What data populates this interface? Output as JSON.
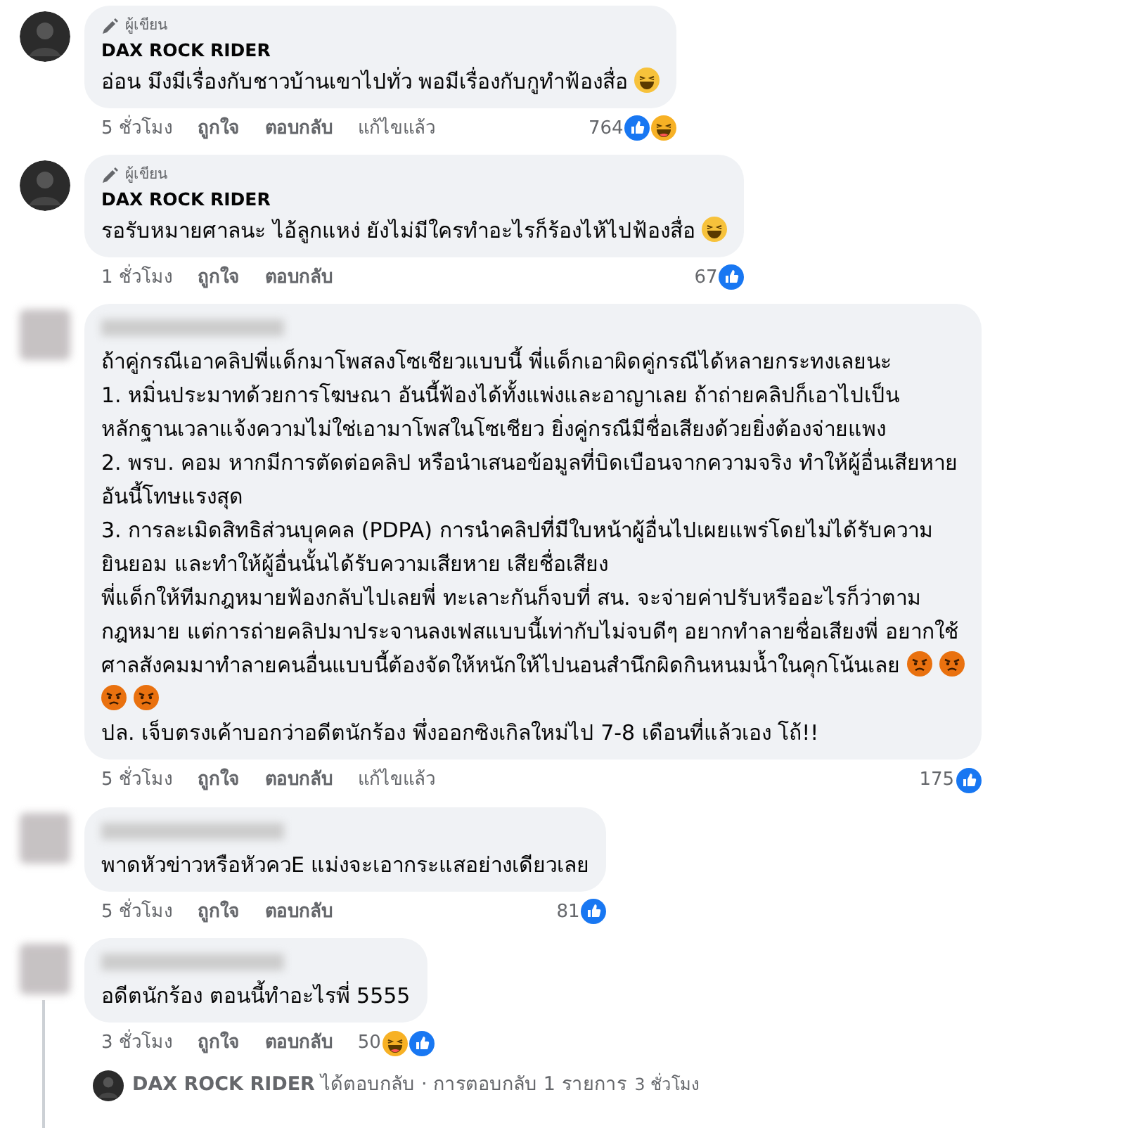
{
  "comments": [
    {
      "avatar": {
        "kind": "photo"
      },
      "author_badge": "ผู้เขียน",
      "name": "DAX ROCK RIDER",
      "paragraphs": [
        [
          {
            "text": "อ่อน มึงมีเรื่องกับชาวบ้านเขาไปทั่ว พอมีเรื่องกับกูทำฟ้องสื่อ",
            "emojis": [
              {
                "kind": "laugh"
              }
            ]
          }
        ]
      ],
      "time": "5 ชั่วโมง",
      "actions": [
        "ถูกใจ",
        "ตอบกลับ"
      ],
      "edited": "แก้ไขแล้ว",
      "count": "764",
      "reactions": [
        {
          "kind": "like"
        },
        {
          "kind": "haha"
        }
      ]
    },
    {
      "avatar": {
        "kind": "photo"
      },
      "author_badge": "ผู้เขียน",
      "name": "DAX ROCK RIDER",
      "paragraphs": [
        [
          {
            "text": "รอรับหมายศาลนะ ไอ้ลูกแหง่ ยังไม่มีใครทำอะไรก็ร้องไห้ไปฟ้องสื่อ",
            "emojis": [
              {
                "kind": "laugh"
              }
            ]
          }
        ]
      ],
      "time": "1 ชั่วโมง",
      "actions": [
        "ถูกใจ",
        "ตอบกลับ"
      ],
      "count": "67",
      "reactions": [
        {
          "kind": "like"
        }
      ]
    },
    {
      "avatar": {
        "kind": "blurred"
      },
      "paragraphs": [
        [
          {
            "text": "ถ้าคู่กรณีเอาคลิปพี่แด็กมาโพสลงโซเชียวแบบนี้ พี่แด็กเอาผิดคู่กรณีได้หลายกระทงเลยนะ"
          }
        ],
        [
          {
            "text": "1. หมิ่นประมาทด้วยการโฆษณา อันนี้ฟ้องได้ทั้งแพ่งและอาญาเลย ถ้าถ่ายคลิปก็เอาไปเป็น"
          },
          {
            "text": "หลักฐานเวลาแจ้งความไม่ใช่เอามาโพสในโซเชียว ยิ่งคู่กรณีมีชื่อเสียงด้วยยิ่งต้องจ่ายแพง"
          }
        ],
        [
          {
            "text": "2. พรบ. คอม หากมีการตัดต่อคลิป หรือนำเสนอข้อมูลที่บิดเบือนจากความจริง ทำให้ผู้อื่นเสียหาย"
          },
          {
            "text": "อันนี้โทษแรงสุด"
          }
        ],
        [
          {
            "text": "3. การละเมิดสิทธิส่วนบุคคล (PDPA) การนำคลิปที่มีใบหน้าผู้อื่นไปเผยแพร่โดยไม่ได้รับความ"
          },
          {
            "text": "ยินยอม และทำให้ผู้อื่นนั้นได้รับความเสียหาย เสียชื่อเสียง"
          }
        ],
        [
          {
            "text": "พี่แด็กให้ทีมกฎหมายฟ้องกลับไปเลยพี่ ทะเลาะกันก็จบที่ สน. จะจ่ายค่าปรับหรืออะไรก็ว่าตาม"
          },
          {
            "text": "กฎหมาย แต่การถ่ายคลิปมาประจานลงเฟสแบบนี้เท่ากับไม่จบดีๆ อยากทำลายชื่อเสียงพี่ อยากใช้"
          },
          {
            "text": "ศาลสังคมมาทำลายคนอื่นแบบนี้ต้องจัดให้หนักให้ไปนอนสำนึกผิดกินหนมน้ำในคุกโน้นเลย",
            "emojis": [
              {
                "kind": "angry"
              },
              {
                "kind": "angry"
              }
            ]
          },
          {
            "emojis": [
              {
                "kind": "angry"
              },
              {
                "kind": "angry"
              }
            ]
          }
        ],
        [
          {
            "text": "ปล. เจ็บตรงเค้าบอกว่าอดีตนักร้อง พึ่งออกซิงเกิลใหม่ไป 7-8 เดือนที่แล้วเอง โถ้!!"
          }
        ]
      ],
      "time": "5 ชั่วโมง",
      "actions": [
        "ถูกใจ",
        "ตอบกลับ"
      ],
      "edited": "แก้ไขแล้ว",
      "count": "175",
      "reactions": [
        {
          "kind": "like"
        }
      ]
    },
    {
      "avatar": {
        "kind": "blurred"
      },
      "paragraphs": [
        [
          {
            "text": "พาดหัวข่าวหรือหัวควE แม่งจะเอากระแสอย่างเดียวเลย"
          }
        ]
      ],
      "time": "5 ชั่วโมง",
      "actions": [
        "ถูกใจ",
        "ตอบกลับ"
      ],
      "count": "81",
      "reactions": [
        {
          "kind": "like"
        }
      ]
    },
    {
      "avatar": {
        "kind": "blurred"
      },
      "paragraphs": [
        [
          {
            "text": "อดีตนักร้อง ตอนนี้ทำอะไรพี่ 5555"
          }
        ]
      ],
      "time": "3 ชั่วโมง",
      "actions": [
        "ถูกใจ",
        "ตอบกลับ"
      ],
      "count": "50",
      "reactions": [
        {
          "kind": "haha"
        },
        {
          "kind": "like"
        }
      ],
      "reply_summary": {
        "avatar": {
          "kind": "photo"
        },
        "name": "DAX ROCK RIDER",
        "text": "ได้ตอบกลับ · การตอบกลับ 1 รายการ",
        "time": "3 ชั่วโมง"
      }
    }
  ]
}
